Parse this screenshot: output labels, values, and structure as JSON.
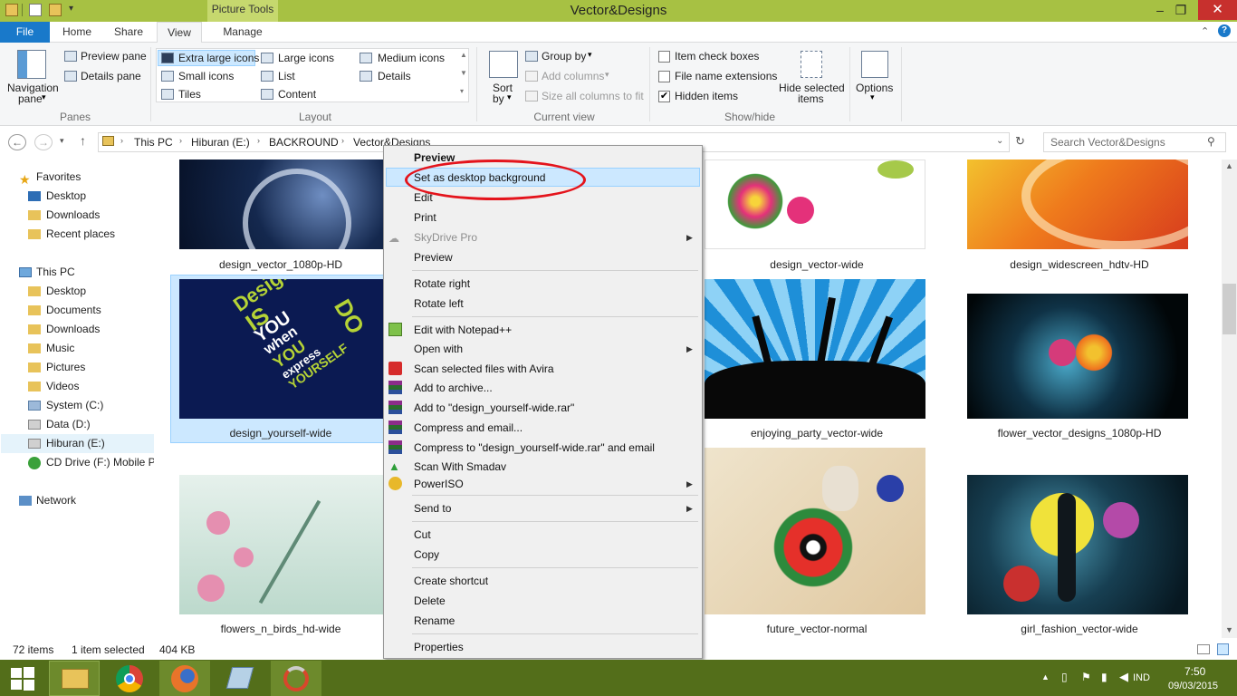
{
  "window": {
    "title": "Vector&Designs",
    "contextual_tab": "Picture Tools"
  },
  "tabs": [
    {
      "label": "File"
    },
    {
      "label": "Home"
    },
    {
      "label": "Share"
    },
    {
      "label": "View"
    },
    {
      "label": "Manage"
    }
  ],
  "ribbon": {
    "panes": {
      "navigation_pane": "Navigation",
      "navigation_pane2": "pane",
      "preview_pane": "Preview pane",
      "details_pane": "Details pane",
      "group": "Panes"
    },
    "layout": {
      "extra_large_icons": "Extra large icons",
      "large_icons": "Large icons",
      "medium_icons": "Medium icons",
      "small_icons": "Small icons",
      "list": "List",
      "details": "Details",
      "tiles": "Tiles",
      "content": "Content",
      "group": "Layout"
    },
    "current_view": {
      "sort_by": "Sort",
      "sort_by2": "by",
      "group_by": "Group by",
      "add_columns": "Add columns",
      "size_all_columns": "Size all columns to fit",
      "group": "Current view"
    },
    "show_hide": {
      "item_check_boxes": "Item check boxes",
      "file_name_extensions": "File name extensions",
      "hidden_items": "Hidden items",
      "hide_selected_items": "Hide selected",
      "hide_selected_items2": "items",
      "group": "Show/hide",
      "checks": {
        "item_check_boxes": false,
        "file_name_extensions": false,
        "hidden_items": true
      }
    },
    "options": "Options"
  },
  "address": {
    "crumbs": [
      "This PC",
      "Hiburan (E:)",
      "BACKROUND",
      "Vector&Designs"
    ],
    "search_placeholder": "Search Vector&Designs"
  },
  "nav": {
    "favorites": "Favorites",
    "desktop": "Desktop",
    "downloads": "Downloads",
    "recent_places": "Recent places",
    "this_pc": "This PC",
    "pc_desktop": "Desktop",
    "documents": "Documents",
    "pc_downloads": "Downloads",
    "music": "Music",
    "pictures": "Pictures",
    "videos": "Videos",
    "system_c": "System (C:)",
    "data_d": "Data (D:)",
    "hiburan_e": "Hiburan (E:)",
    "cd_drive": "CD Drive (F:) Mobile Pa",
    "network": "Network"
  },
  "files": [
    {
      "name": "design_vector_1080p-HD"
    },
    {
      "name": "design_vector-wide"
    },
    {
      "name": "design_widescreen_hdtv-HD"
    },
    {
      "name": "design_yourself-wide"
    },
    {
      "name": "enjoying_party_vector-wide"
    },
    {
      "name": "flower_vector_designs_1080p-HD"
    },
    {
      "name": "flowers_n_birds_hd-wide"
    },
    {
      "name": "future_vector-normal"
    },
    {
      "name": "girl_fashion_vector-wide"
    }
  ],
  "thumb_text": {
    "line1": "Design",
    "line2": "IS",
    "line3": "YOU",
    "line4": "when",
    "line5": "express",
    "line6": "YOURSELF",
    "line7": "DO",
    "line8": "YOU"
  },
  "context_menu": {
    "preview_top": "Preview",
    "set_desktop": "Set as desktop background",
    "edit": "Edit",
    "print": "Print",
    "skydrive": "SkyDrive Pro",
    "preview": "Preview",
    "rotate_right": "Rotate right",
    "rotate_left": "Rotate left",
    "notepad": "Edit with Notepad++",
    "open_with": "Open with",
    "avira": "Scan selected files with Avira",
    "add_archive": "Add to archive...",
    "add_rar": "Add to \"design_yourself-wide.rar\"",
    "compress_email": "Compress and email...",
    "compress_rar_email": "Compress to \"design_yourself-wide.rar\" and email",
    "smadav": "Scan With Smadav",
    "poweriso": "PowerISO",
    "send_to": "Send to",
    "cut": "Cut",
    "copy": "Copy",
    "create_shortcut": "Create shortcut",
    "delete": "Delete",
    "rename": "Rename",
    "properties": "Properties"
  },
  "status": {
    "items": "72 items",
    "selected": "1 item selected",
    "size": "404 KB"
  },
  "taskbar": {
    "lang": "IND",
    "time": "7:50",
    "date": "09/03/2015"
  }
}
